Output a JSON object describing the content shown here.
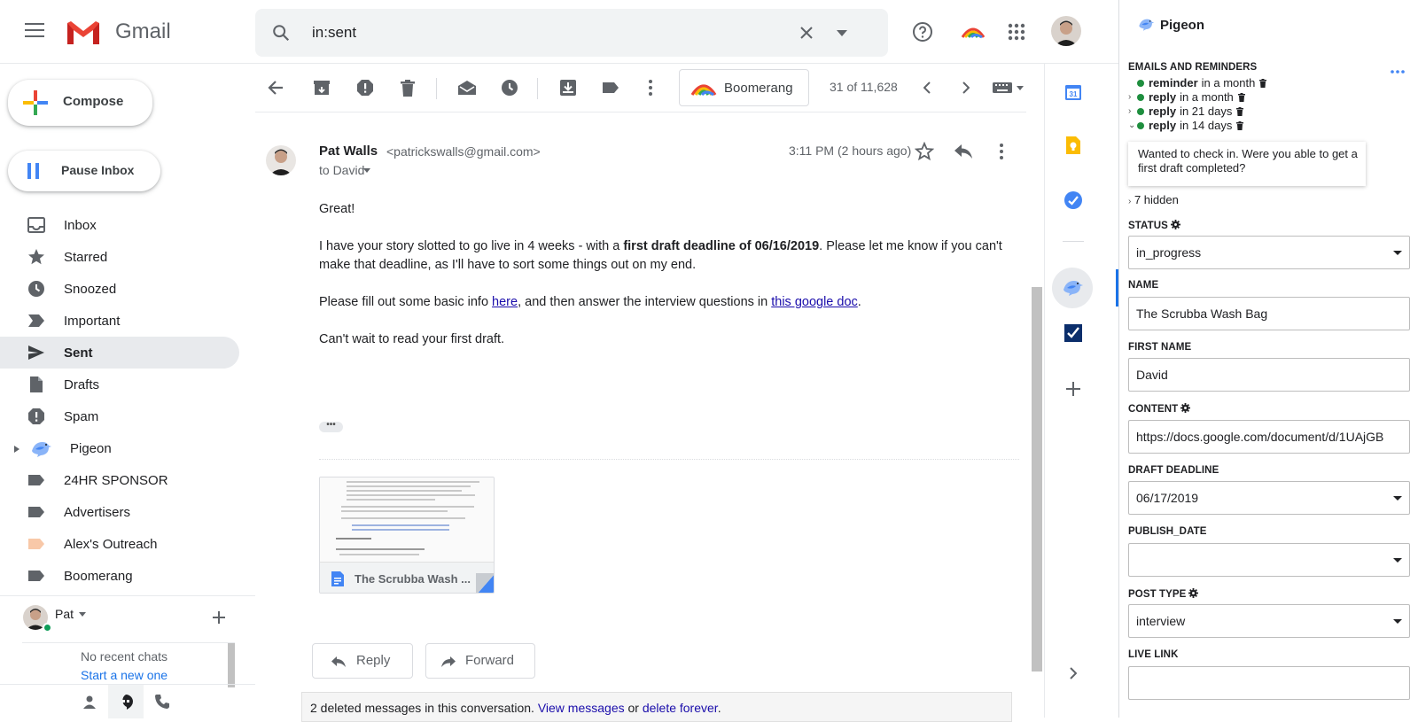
{
  "app": {
    "brand": "Gmail"
  },
  "search": {
    "query": "in:sent"
  },
  "nav": {
    "compose_label": "Compose",
    "pause_label": "Pause Inbox",
    "items": [
      {
        "label": "Inbox",
        "icon": "inbox-icon"
      },
      {
        "label": "Starred",
        "icon": "star-icon"
      },
      {
        "label": "Snoozed",
        "icon": "clock-icon"
      },
      {
        "label": "Important",
        "icon": "important-icon"
      },
      {
        "label": "Sent",
        "icon": "send-icon",
        "active": true
      },
      {
        "label": "Drafts",
        "icon": "draft-icon"
      },
      {
        "label": "Spam",
        "icon": "spam-icon"
      },
      {
        "label": "Pigeon",
        "icon": "pigeon-icon"
      },
      {
        "label": "24HR SPONSOR",
        "icon": "label-icon"
      },
      {
        "label": "Advertisers",
        "icon": "label-icon"
      },
      {
        "label": "Alex's Outreach",
        "icon": "label-icon",
        "color": "#f8c8a8"
      },
      {
        "label": "Boomerang",
        "icon": "label-icon"
      }
    ]
  },
  "chat": {
    "user": "Pat",
    "no_chats": "No recent chats",
    "start_link": "Start a new one"
  },
  "toolbar": {
    "boomerang_label": "Boomerang",
    "pagination": "31 of 11,628"
  },
  "message": {
    "sender_name": "Pat Walls",
    "sender_email": "<patrickswalls@gmail.com>",
    "to": "to David",
    "time": "3:11 PM (2 hours ago)",
    "greeting": "Great!",
    "p1_before": "I have your story slotted to go live in 4 weeks - with a ",
    "p1_bold": "first draft deadline of 06/16/2019",
    "p1_after": ". Please let me know if you can't make that deadline, as I'll have to sort some things out on my end.",
    "p2_before": "Please fill out some basic info ",
    "p2_link1": "here",
    "p2_middle": ", and then answer the interview questions in ",
    "p2_link2": "this google doc",
    "p2_after": ".",
    "p3": "Can't wait to read your first draft.",
    "attachment_name": "The Scrubba Wash ...",
    "reply_label": "Reply",
    "forward_label": "Forward",
    "deleted_text": "2 deleted messages in this conversation. ",
    "view_link": "View messages",
    "or_text": " or ",
    "delete_link": "delete forever",
    "period": "."
  },
  "pigeon": {
    "title": "Pigeon",
    "emails_heading": "EMAILS AND REMINDERS",
    "reminders": [
      {
        "kind": "reminder",
        "when": "in a month",
        "caret": ""
      },
      {
        "kind": "reply",
        "when": "in a month",
        "caret": "›"
      },
      {
        "kind": "reply",
        "when": "in 21 days",
        "caret": "›"
      },
      {
        "kind": "reply",
        "when": "in 14 days",
        "caret": "⌄"
      }
    ],
    "reminder_text": "Wanted to check in. Were you able to get a first draft completed?",
    "hidden_text": "7 hidden",
    "hidden_caret": "›",
    "status_label": "STATUS",
    "status_value": "in_progress",
    "name_label": "NAME",
    "name_value": "The Scrubba Wash Bag",
    "first_name_label": "FIRST NAME",
    "first_name_value": "David",
    "content_label": "CONTENT",
    "content_value": "https://docs.google.com/document/d/1UAjGB",
    "draft_deadline_label": "DRAFT DEADLINE",
    "draft_deadline_value": "06/17/2019",
    "publish_date_label": "PUBLISH_DATE",
    "publish_date_value": "",
    "post_type_label": "POST TYPE",
    "post_type_value": "interview",
    "live_link_label": "LIVE LINK",
    "live_link_value": ""
  },
  "colors": {
    "gmail_red": "#ea4335",
    "link_blue": "#1a0dab",
    "active_nav": "#e8eaed",
    "pigeon_accent": "#4285f4",
    "status_green": "#1e8e3e"
  }
}
